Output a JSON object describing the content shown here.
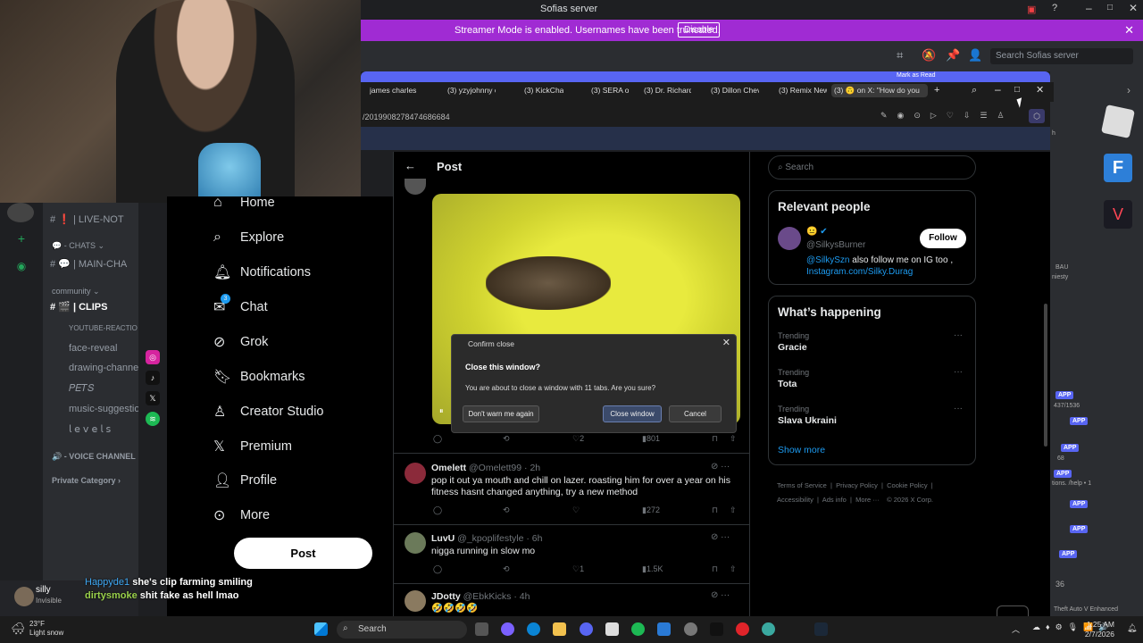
{
  "discord": {
    "server_title": "Sofias server",
    "banner_text": "Streamer Mode is enabled. Usernames have been truncated.",
    "banner_button": "Disable",
    "search_placeholder": "Search Sofias server",
    "channels": {
      "live": "❗ | LIVE-NOT",
      "chats_cat": "💬 - CHATS ⌄",
      "main_chat": "💬 | MAIN-CHA",
      "community_cat": "community ⌄",
      "clips": "🎬 | CLIPS",
      "youtube": "YOUTUBE-REACTIO",
      "face_reveal": "face-reveal",
      "drawing": "drawing-channe",
      "pets": "𝑃𝐸𝑇𝑆",
      "music": "music-suggestio",
      "levels": "𝗅 𝖾 𝗏 𝖾 𝗅 𝗌",
      "voice_cat": "🔊 - VOICE CHANNEL",
      "private_cat": "Private Category ›"
    },
    "user": {
      "name": "silly",
      "status": "Invisible"
    },
    "overlay_chat": [
      {
        "user": "Happyde1",
        "msg": "she's clip farming smiling",
        "color": "#3fa9f5"
      },
      {
        "user": "dirtysmoke",
        "msg": "shit fake as hell lmao",
        "color": "#9ad14b"
      }
    ],
    "right_peek": {
      "bau": "BAU",
      "niesty": "niesty",
      "app": "APP",
      "count": "437/1536",
      "help": "tions. /help • 1",
      "num": "36",
      "game": "Theft Auto V Enhanced",
      "h": "h",
      "n": "68"
    }
  },
  "browser": {
    "tabs": [
      "james charles",
      "(3) yzyjohnny o",
      "(3) KickChamp",
      "(3) SERA on X:",
      "(3) Dr. Richard",
      "(3) Dillon Chev",
      "(3) Remix News",
      "(3) 🙃 on X: \"How do you"
    ],
    "url": "/2019908278474686684",
    "top_peek": "Mark as Read"
  },
  "x": {
    "nav": [
      "Home",
      "Explore",
      "Notifications",
      "Chat",
      "Grok",
      "Bookmarks",
      "Creator Studio",
      "Premium",
      "Profile",
      "More"
    ],
    "chat_badge": "3",
    "post_button": "Post",
    "header_title": "Post",
    "media_actions": {
      "likes": "2",
      "views": "801"
    },
    "tweets": [
      {
        "name": "Omelett",
        "handle": "@Omelett99 · 2h",
        "text": "pop it out ya mouth and chill on lazer. roasting him for over a year on his fitness hasnt changed anything, try a new method",
        "likes": "",
        "views": "272"
      },
      {
        "name": "LuvU",
        "handle": "@_kpoplifestyle · 6h",
        "text": "nigga running in slow mo",
        "likes": "1",
        "views": "1.5K"
      },
      {
        "name": "JDotty",
        "handle": "@EbkKicks · 4h",
        "text": "🤣🤣🤣🤣",
        "likes": "",
        "views": ""
      }
    ],
    "search_placeholder": "Search",
    "relevant": {
      "title": "Relevant people",
      "handle": "@SilkysBurner",
      "bio_link": "@SilkySzn",
      "bio_text": " also follow me on IG too ,",
      "bio_link2": "Instagram.com/Silky.Durag",
      "follow": "Follow"
    },
    "happening": {
      "title": "What’s happening",
      "trends": [
        {
          "label": "Trending",
          "value": "Gracie"
        },
        {
          "label": "Trending",
          "value": "Tota"
        },
        {
          "label": "Trending",
          "value": "Slava Ukraini"
        }
      ],
      "show_more": "Show more"
    },
    "footer": [
      "Terms of Service",
      "Privacy Policy",
      "Cookie Policy",
      "Accessibility",
      "Ads info",
      "More ···",
      "© 2026 X Corp."
    ]
  },
  "dialog": {
    "title": "Confirm close",
    "question": "Close this window?",
    "message": "You are about to close a window with 11 tabs. Are you sure?",
    "dont_warn": "Don't warn me again",
    "close_window": "Close window",
    "cancel": "Cancel"
  },
  "taskbar": {
    "temp": "23°F",
    "weather": "Light snow",
    "search": "Search",
    "time": "1:25 AM",
    "date": "2/7/2026"
  }
}
